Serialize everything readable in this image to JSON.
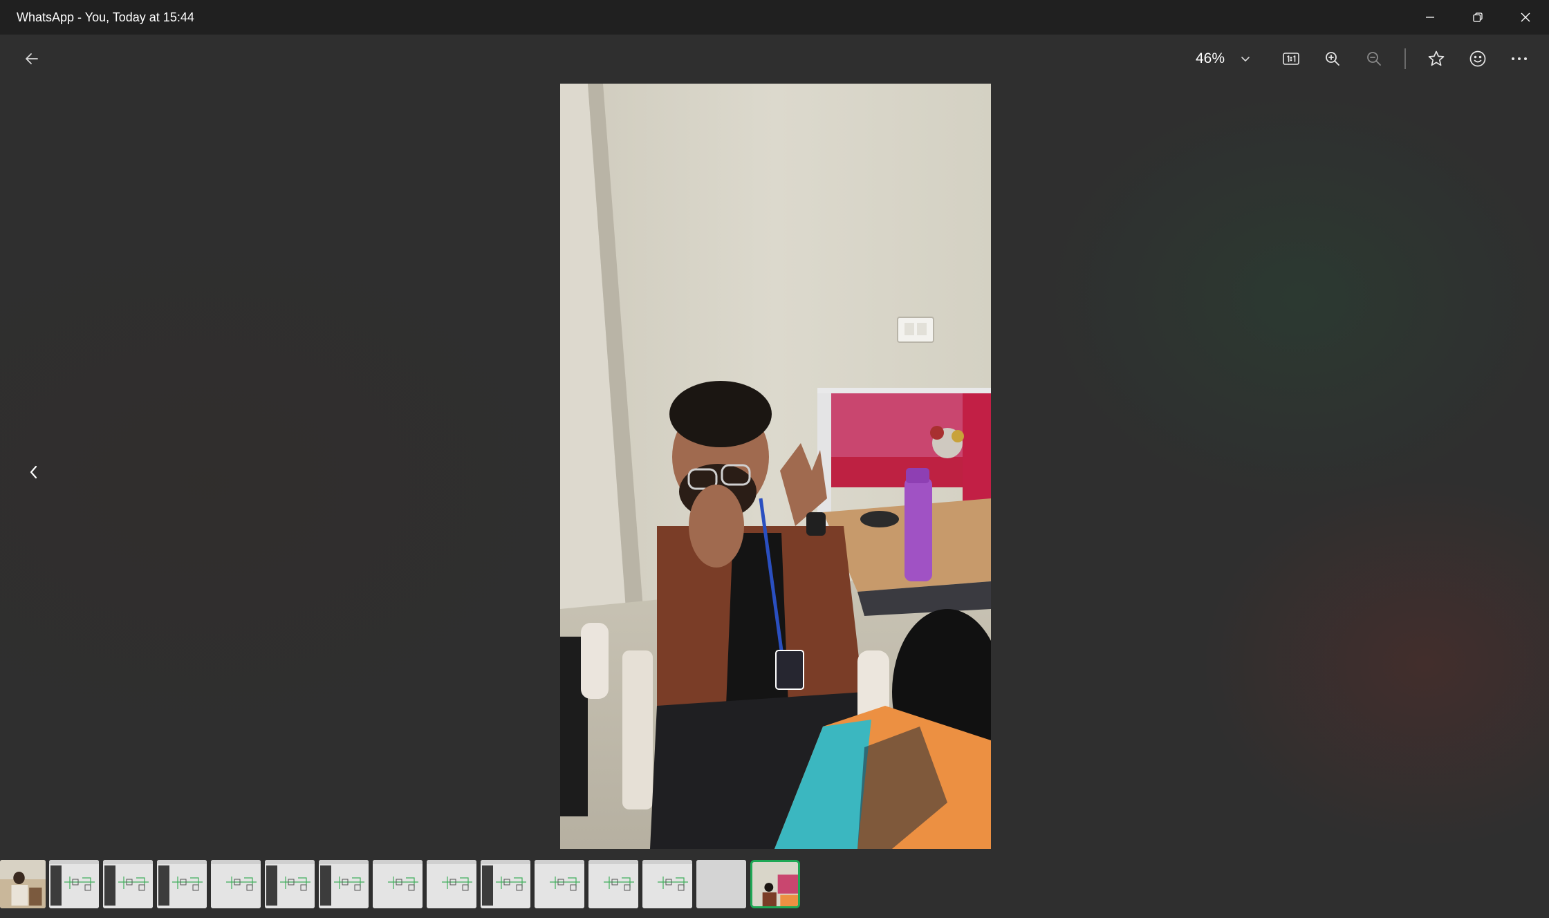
{
  "window": {
    "title": "WhatsApp - You, Today at 15:44",
    "minimize_icon": "minimize-icon",
    "restore_icon": "restore-icon",
    "close_icon": "close-icon"
  },
  "toolbar": {
    "back_icon": "arrow-left-icon",
    "zoom_level": "46%",
    "zoom_dropdown_icon": "chevron-down-icon",
    "actual_size_icon": "actual-size-icon",
    "zoom_in_icon": "zoom-in-icon",
    "zoom_out_icon": "zoom-out-icon",
    "favorite_icon": "star-icon",
    "react_icon": "emoji-icon",
    "more_icon": "more-icon"
  },
  "viewer": {
    "previous_icon": "chevron-left-icon"
  },
  "filmstrip": {
    "count": 15,
    "selected_index": 14,
    "items": [
      {
        "type": "photo"
      },
      {
        "type": "diagram-screenshot-dark-panel"
      },
      {
        "type": "diagram-screenshot-dark-panel"
      },
      {
        "type": "diagram-screenshot-dark-panel"
      },
      {
        "type": "diagram-screenshot"
      },
      {
        "type": "diagram-screenshot-dark-panel"
      },
      {
        "type": "diagram-screenshot-dark-panel"
      },
      {
        "type": "diagram-screenshot"
      },
      {
        "type": "diagram-screenshot"
      },
      {
        "type": "diagram-screenshot-dark-panel"
      },
      {
        "type": "diagram-screenshot"
      },
      {
        "type": "diagram-screenshot"
      },
      {
        "type": "diagram-screenshot"
      },
      {
        "type": "blank"
      },
      {
        "type": "photo",
        "selected": true
      }
    ]
  },
  "colors": {
    "titlebar": "#202020",
    "background": "#2f2f2f",
    "selection": "#1fa855"
  }
}
